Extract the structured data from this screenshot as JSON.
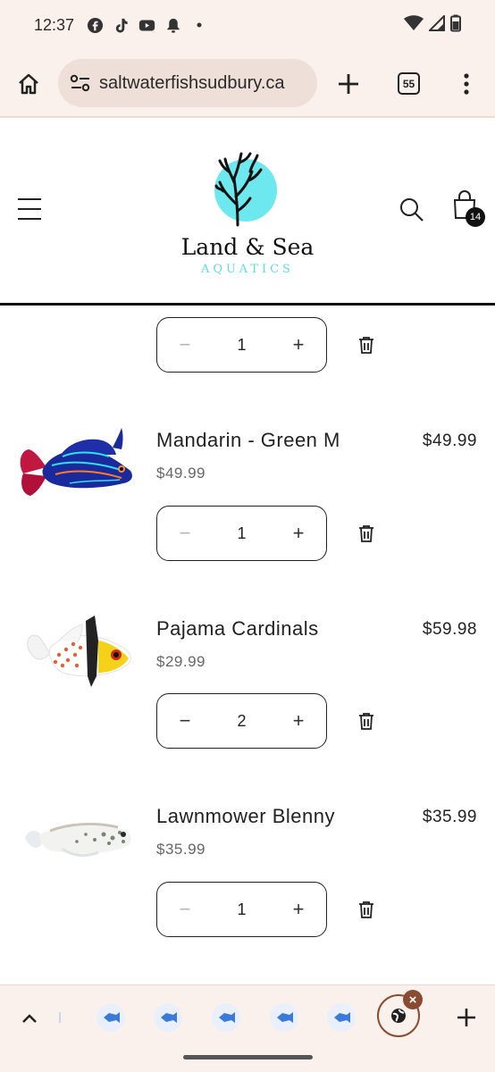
{
  "status_bar": {
    "time": "12:37",
    "left_icons": [
      "facebook-icon",
      "tiktok-icon",
      "youtube-icon",
      "bell-icon",
      "dot-icon"
    ],
    "right_icons": [
      "wifi-icon",
      "signal-icon",
      "battery-icon"
    ]
  },
  "browser": {
    "url": "saltwaterfishsudbury.ca",
    "tabs_count": "55"
  },
  "site": {
    "logo_title": "Land & Sea",
    "logo_subtitle": "AQUATICS",
    "cart_count": "14"
  },
  "cart": {
    "items": [
      {
        "name": "",
        "unit_price": "",
        "total": "",
        "quantity": "1",
        "image": "hidden"
      },
      {
        "name": "Mandarin - Green M",
        "unit_price": "$49.99",
        "total": "$49.99",
        "quantity": "1",
        "image": "mandarin-fish-image"
      },
      {
        "name": "Pajama Cardinals",
        "unit_price": "$29.99",
        "total": "$59.98",
        "quantity": "2",
        "image": "pajama-cardinal-image"
      },
      {
        "name": "Lawnmower Blenny",
        "unit_price": "$35.99",
        "total": "$35.99",
        "quantity": "1",
        "image": "lawnmower-blenny-image"
      }
    ],
    "minus_label": "−",
    "plus_label": "+"
  },
  "tab_strip": {
    "close_label": "×",
    "add_label": "+"
  },
  "colors": {
    "chrome_bg": "#fbf1ec",
    "url_pill": "#eedfd8",
    "logo_accent": "#6de8ef",
    "active_tab_ring": "#8a4b33"
  }
}
